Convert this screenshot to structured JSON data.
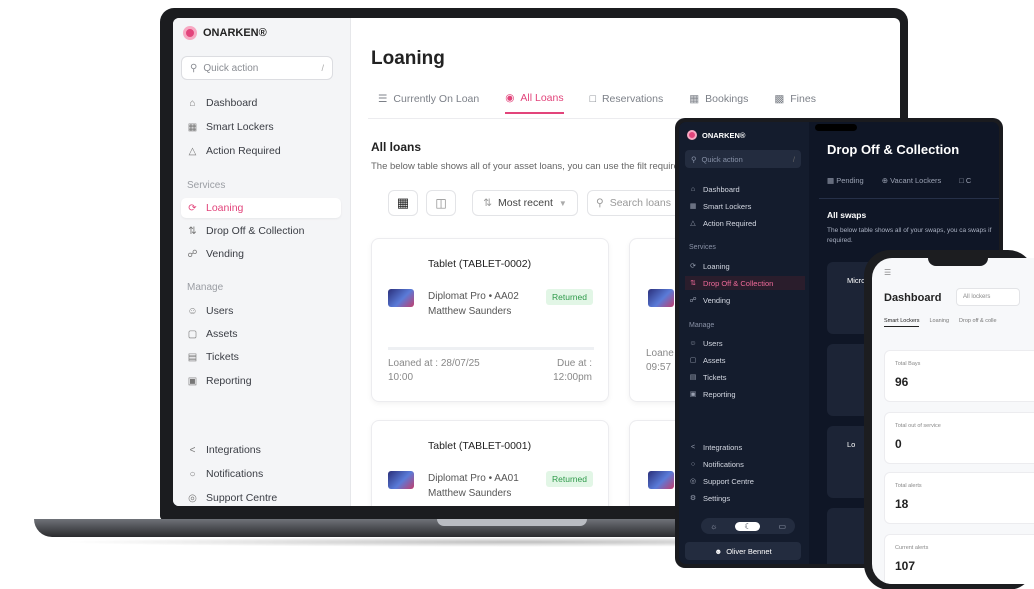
{
  "laptop": {
    "brand": "ONARKEN®",
    "quick_action": "Quick action",
    "quick_action_key": "/",
    "nav_main": [
      {
        "label": "Dashboard",
        "icon": "home-icon"
      },
      {
        "label": "Smart Lockers",
        "icon": "locker-icon"
      },
      {
        "label": "Action Required",
        "icon": "warning-icon"
      }
    ],
    "section_services": "Services",
    "nav_services": [
      {
        "label": "Loaning",
        "icon": "refresh-icon"
      },
      {
        "label": "Drop Off & Collection",
        "icon": "swap-icon"
      },
      {
        "label": "Vending",
        "icon": "cart-icon"
      }
    ],
    "section_manage": "Manage",
    "nav_manage": [
      {
        "label": "Users",
        "icon": "users-icon"
      },
      {
        "label": "Assets",
        "icon": "asset-icon"
      },
      {
        "label": "Tickets",
        "icon": "ticket-icon"
      },
      {
        "label": "Reporting",
        "icon": "report-icon"
      }
    ],
    "nav_footer": [
      {
        "label": "Integrations",
        "icon": "share-icon"
      },
      {
        "label": "Notifications",
        "icon": "bell-icon"
      },
      {
        "label": "Support Centre",
        "icon": "support-icon"
      }
    ],
    "page_title": "Loaning",
    "tabs": [
      "Currently On Loan",
      "All Loans",
      "Reservations",
      "Bookings",
      "Fines"
    ],
    "active_tab": "All Loans",
    "section_title": "All loans",
    "description": "The below table shows all of your asset loans, you can use the filt required.",
    "sort_label": "Most recent",
    "search_placeholder": "Search loans",
    "cards": [
      {
        "title": "Tablet (TABLET-0002)",
        "sub1": "Diplomat Pro • AA02",
        "sub2": "Matthew Saunders",
        "status": "Returned",
        "loaned": "Loaned at : 28/07/25 10:00",
        "due": "Due at : 12:00pm"
      },
      {
        "title": "Tablet (TABLET-0001)",
        "sub1": "Diplomat Pro • AA01",
        "sub2": "Matthew Saunders",
        "status": "Returned",
        "loaned": "",
        "due": ""
      }
    ],
    "partial_card": {
      "loaned": "Loane 09:57"
    }
  },
  "tablet": {
    "brand": "ONARKEN®",
    "quick_action": "Quick action",
    "quick_action_key": "/",
    "nav_main": [
      "Dashboard",
      "Smart Lockers",
      "Action Required"
    ],
    "section_services": "Services",
    "nav_services": [
      "Loaning",
      "Drop Off & Collection",
      "Vending"
    ],
    "section_manage": "Manage",
    "nav_manage": [
      "Users",
      "Assets",
      "Tickets",
      "Reporting"
    ],
    "nav_footer": [
      "Integrations",
      "Notifications",
      "Support Centre",
      "Settings"
    ],
    "user": "Oliver Bennet",
    "page_title": "Drop Off & Collection",
    "tabs": [
      "Pending",
      "Vacant Lockers",
      "C"
    ],
    "section_title": "All swaps",
    "description": "The below table shows all of your swaps, you ca swaps if required.",
    "card_titles": [
      "Micros",
      "",
      "Lo",
      ""
    ]
  },
  "phone": {
    "title": "Dashboard",
    "filter": "All lockers",
    "tabs": [
      "Smart Lockers",
      "Loaning",
      "Drop off & colle"
    ],
    "stats": [
      {
        "label": "Total Bays",
        "value": "96"
      },
      {
        "label": "Total out of service",
        "value": "0"
      },
      {
        "label": "Total alerts",
        "value": "18"
      },
      {
        "label": "Current alerts",
        "value": "107"
      }
    ]
  },
  "colors": {
    "accent": "#e2447b",
    "success": "#2e9a4a",
    "dark_bg": "#0f1626"
  }
}
